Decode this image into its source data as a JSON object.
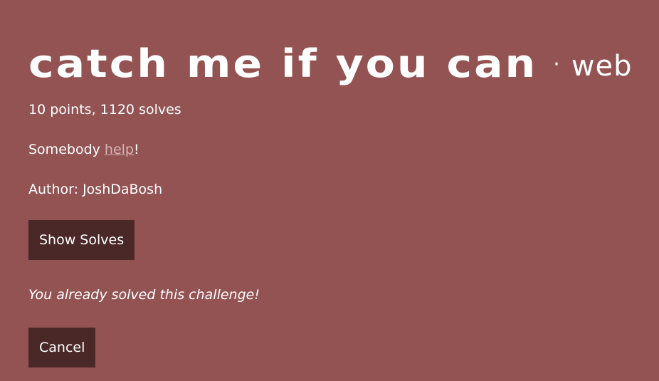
{
  "challenge": {
    "title": "catch me if you can",
    "separator": "·",
    "category": "web",
    "points_line": "10 points, 1120 solves",
    "description_before": "Somebody ",
    "description_link": "help",
    "description_after": "!",
    "author_line": "Author: JoshDaBosh",
    "solved_message": "You already solved this challenge!"
  },
  "buttons": {
    "show_solves": "Show Solves",
    "cancel": "Cancel"
  },
  "colors": {
    "background": "#935353",
    "button": "#4a2828",
    "link": "#d7b5b5",
    "text": "#ffffff"
  }
}
